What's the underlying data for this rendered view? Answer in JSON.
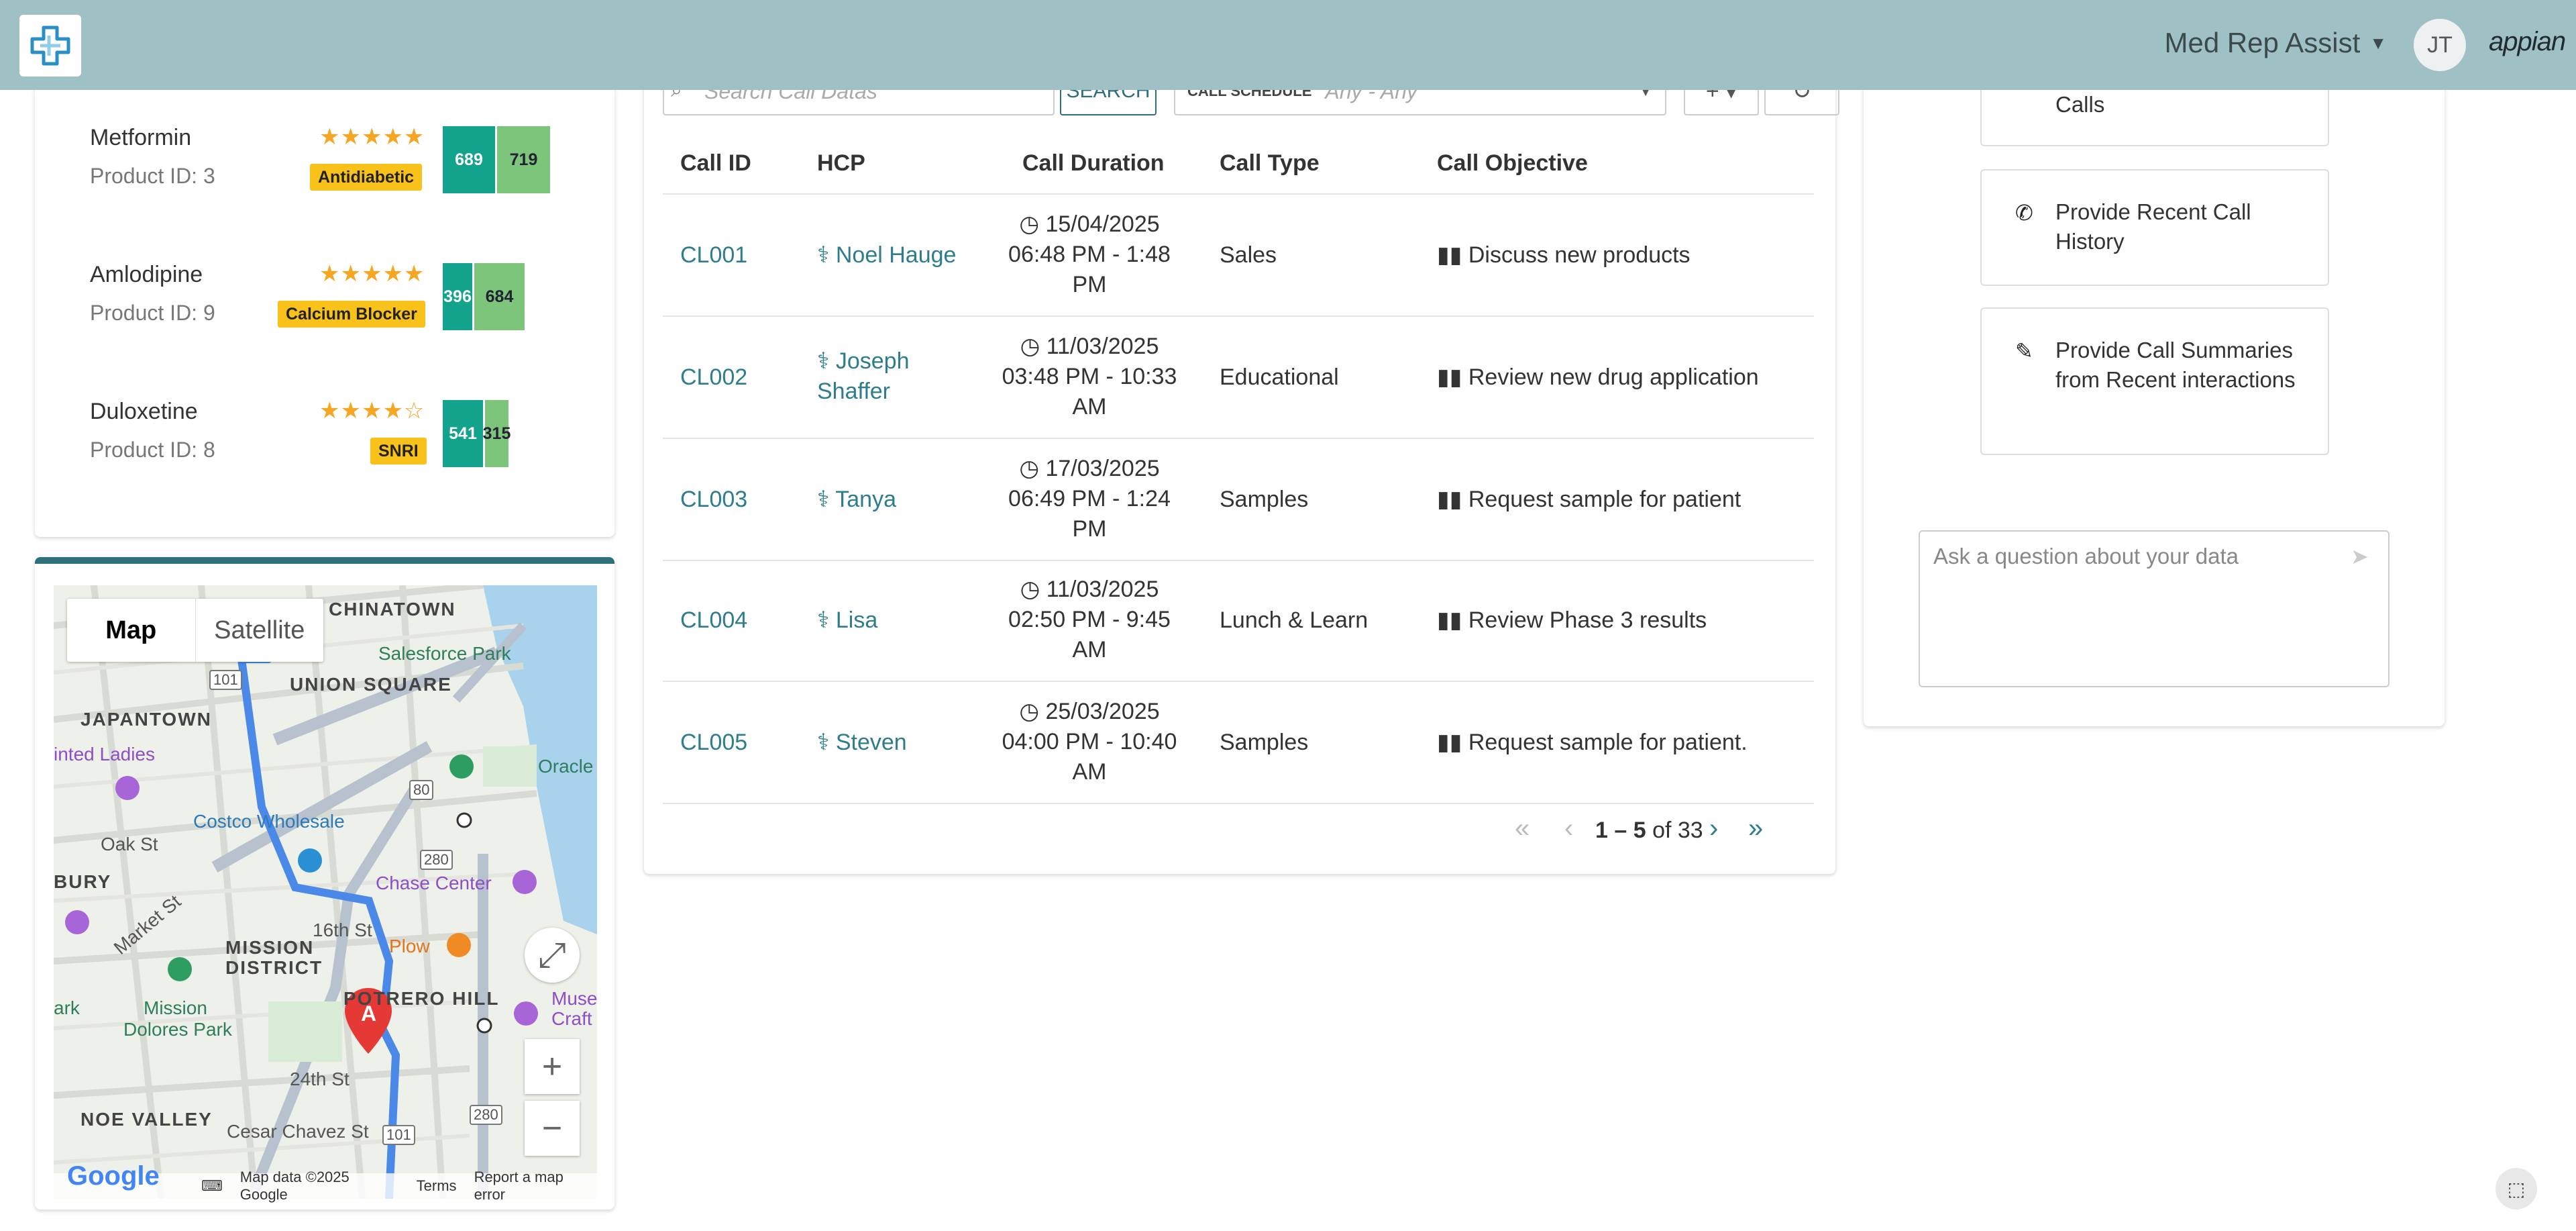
{
  "header": {
    "app_name": "Med Rep Assist",
    "avatar_initials": "JT",
    "brand": "appian",
    "bg_color": "#9fc1c6"
  },
  "products": [
    {
      "name": "Metformin",
      "product_id": "Product ID: 3",
      "stars": "★★★★★",
      "category": "Antidiabetic",
      "bar_a": "689",
      "bar_b": "719"
    },
    {
      "name": "Amlodipine",
      "product_id": "Product ID: 9",
      "stars": "★★★★★",
      "category": "Calcium Blocker",
      "bar_a": "396",
      "bar_b": "684"
    },
    {
      "name": "Duloxetine",
      "product_id": "Product ID: 8",
      "stars": "★★★★☆",
      "category": "SNRI",
      "bar_a": "541",
      "bar_b": "315"
    }
  ],
  "map": {
    "tab_map": "Map",
    "tab_satellite": "Satellite",
    "labels": {
      "chinatown": "CHINATOWN",
      "union_square": "UNION SQUARE",
      "salesforce_park": "Salesforce Park",
      "japantown": "JAPANTOWN",
      "painted_ladies": "inted Ladies",
      "oracle": "Oracle",
      "costco": "Costco Wholesale",
      "oak_st": "Oak St",
      "chase_center": "Chase Center",
      "bury": "BURY",
      "market_st": "Market St",
      "mission_district": "MISSION",
      "mission_district_2": "DISTRICT",
      "plow": "Plow",
      "sixteenth": "16th St",
      "mission_dolores": "Mission",
      "mission_dolores_2": "Dolores Park",
      "potrero": "POTRERO HILL",
      "museum": "Muse",
      "museum_2": "Craft",
      "park": "ark",
      "twentyfourth": "24th St",
      "noe_valley": "NOE VALLEY",
      "cesar_chavez": "Cesar Chavez St",
      "marker": "A",
      "hwy101": "101",
      "hwy280": "280",
      "hwy80": "80"
    },
    "footer": {
      "google": "Google",
      "data": "Map data ©2025 Google",
      "terms": "Terms",
      "report": "Report a map error"
    }
  },
  "calls": {
    "search_placeholder": "Search Call Datas",
    "search_button": "SEARCH",
    "schedule_label": "CALL SCHEDULE",
    "schedule_value": "Any - Any",
    "columns": [
      "Call ID",
      "HCP",
      "Call Duration",
      "Call Type",
      "Call Objective"
    ],
    "rows": [
      {
        "id": "CL001",
        "hcp": "Noel Hauge",
        "hcp2": "",
        "dur1": "15/04/2025",
        "dur2": "06:48 PM - 1:48",
        "dur3": "PM",
        "type": "Sales",
        "objective": "Discuss new products"
      },
      {
        "id": "CL002",
        "hcp": "Joseph",
        "hcp2": "Shaffer",
        "dur1": "11/03/2025",
        "dur2": "03:48 PM - 10:33",
        "dur3": "AM",
        "type": "Educational",
        "objective": "Review new drug application"
      },
      {
        "id": "CL003",
        "hcp": "Tanya",
        "hcp2": "",
        "dur1": "17/03/2025",
        "dur2": "06:49 PM - 1:24",
        "dur3": "PM",
        "type": "Samples",
        "objective": "Request sample for patient"
      },
      {
        "id": "CL004",
        "hcp": "Lisa",
        "hcp2": "",
        "dur1": "11/03/2025",
        "dur2": "02:50 PM - 9:45",
        "dur3": "AM",
        "type": "Lunch & Learn",
        "objective": "Review Phase 3 results"
      },
      {
        "id": "CL005",
        "hcp": "Steven",
        "hcp2": "",
        "dur1": "25/03/2025",
        "dur2": "04:00 PM - 10:40",
        "dur3": "AM",
        "type": "Samples",
        "objective": "Request sample for patient."
      }
    ],
    "pager": {
      "range": "1 – 5",
      "of": "of 33"
    }
  },
  "assistant": {
    "suggestion_top": "Calls",
    "suggestion_history": "Provide Recent Call History",
    "suggestion_summaries": "Provide Call Summaries from Recent interactions",
    "ask_placeholder": "Ask a question about your data"
  }
}
